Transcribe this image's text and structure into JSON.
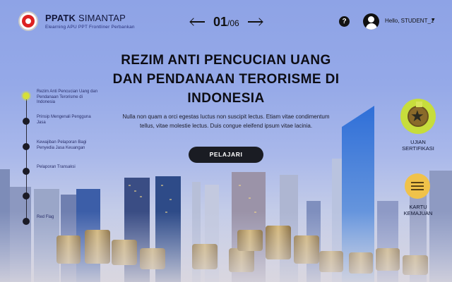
{
  "brand": {
    "title_bold": "PPATK",
    "title_light": "SIMANTAP",
    "subtitle": "Elearning APU PPT Frontliner Perbankan"
  },
  "pager": {
    "current": "01",
    "separator": "/",
    "total": "06"
  },
  "user": {
    "greeting": "Hello, STUDENT_1"
  },
  "hero": {
    "title": "REZIM ANTI PENCUCIAN UANG DAN PENDANAAN TERORISME DI INDONESIA",
    "description": "Nulla non quam a orci egestas luctus non suscipit lectus. Etiam vitae condimentum tellus, vitae molestie lectus. Duis congue eleifend ipsum vitae lacinia.",
    "cta": "PELAJARI"
  },
  "timeline": [
    {
      "label": "Rezim Anti Pencucian Uang dan Pendanaan Terorisme di Indonesia",
      "active": true
    },
    {
      "label": "Prinsip Mengenali Pengguna Jasa",
      "active": false
    },
    {
      "label": "Kewajiban Pelaporan Bagi Penyedia Jasa Keuangan",
      "active": false
    },
    {
      "label": "Pelaporan Transaksi",
      "active": false
    },
    {
      "label": "",
      "active": false
    },
    {
      "label": "Red Flag",
      "active": false
    }
  ],
  "right": {
    "cert_label": "UJIAN SERTIFIKASI",
    "card_label": "KARTU KEMAJUAN"
  },
  "icons": [
    "logo-seal",
    "arrow-left-icon",
    "arrow-right-icon",
    "help-icon",
    "user-avatar-icon",
    "chevron-down-icon",
    "medal-star-icon",
    "list-icon"
  ]
}
